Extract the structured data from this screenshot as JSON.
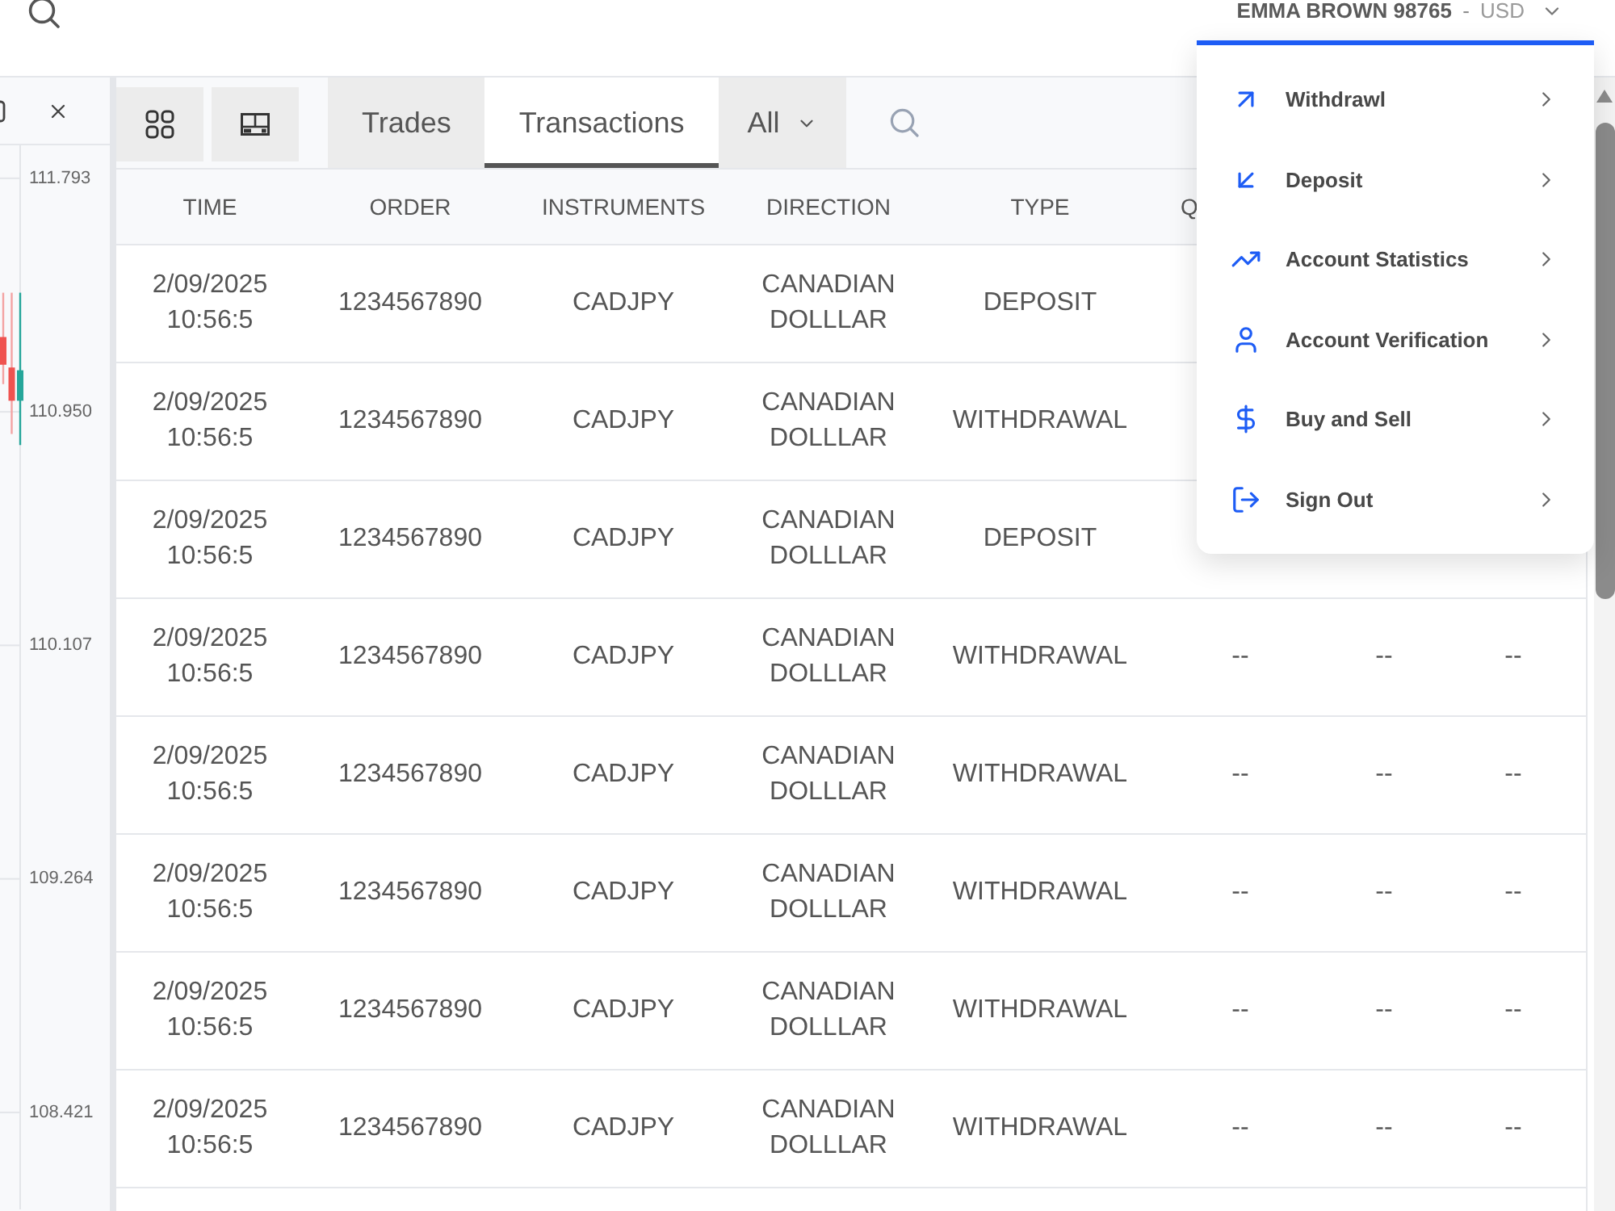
{
  "top_bar": {
    "account": {
      "name": "EMMA BROWN 98765",
      "separator": "-",
      "currency": "USD"
    }
  },
  "account_menu": {
    "expanded": true,
    "items": [
      {
        "kind": "withdraw",
        "label": "Withdrawl"
      },
      {
        "kind": "deposit",
        "label": "Deposit"
      },
      {
        "kind": "statistics",
        "label": "Account Statistics"
      },
      {
        "kind": "verification",
        "label": "Account Verification"
      },
      {
        "kind": "trade",
        "label": "Buy and Sell"
      },
      {
        "kind": "sign_out",
        "label": "Sign Out"
      }
    ]
  },
  "chart_panel": {
    "chart_data": [
      {
        "type": "candlestick",
        "categories": [
          null,
          null,
          null
        ],
        "ohlc": [
          [
            111.22,
            111.38,
            111.05,
            111.12
          ],
          [
            111.11,
            111.38,
            110.87,
            110.99
          ],
          [
            110.99,
            111.38,
            110.83,
            111.1
          ]
        ],
        "yticks": [
          108.421,
          109.264,
          110.107,
          {
            "value": 110.95,
            "label": "110.950"
          },
          111.793
        ],
        "ylim": [
          108.071,
          111.912
        ]
      }
    ]
  },
  "toolbar": {
    "tabs": [
      {
        "label": "Trades",
        "selected": false
      },
      {
        "label": "Transactions",
        "selected": true
      }
    ],
    "filter": {
      "value": "All"
    }
  },
  "table": {
    "columns": [
      "TIME",
      "ORDER",
      "INSTRUMENTS",
      "DIRECTION",
      "TYPE",
      "Q"
    ],
    "rows": [
      {
        "cells": [
          "2/09/2025 10:56:5",
          "1234567890",
          "CADJPY",
          "CANADIAN DOLLLAR",
          "DEPOSIT"
        ]
      },
      {
        "cells": [
          "2/09/2025 10:56:5",
          "1234567890",
          "CADJPY",
          "CANADIAN DOLLLAR",
          "WITHDRAWAL"
        ]
      },
      {
        "cells": [
          "2/09/2025 10:56:5",
          "1234567890",
          "CADJPY",
          "CANADIAN DOLLLAR",
          "DEPOSIT"
        ]
      },
      {
        "cells": [
          "2/09/2025 10:56:5",
          "1234567890",
          "CADJPY",
          "CANADIAN DOLLLAR",
          "WITHDRAWAL",
          "--",
          "--",
          "--"
        ]
      },
      {
        "cells": [
          "2/09/2025 10:56:5",
          "1234567890",
          "CADJPY",
          "CANADIAN DOLLLAR",
          "WITHDRAWAL",
          "--",
          "--",
          "--"
        ]
      },
      {
        "cells": [
          "2/09/2025 10:56:5",
          "1234567890",
          "CADJPY",
          "CANADIAN DOLLLAR",
          "WITHDRAWAL",
          "--",
          "--",
          "--"
        ]
      },
      {
        "cells": [
          "2/09/2025 10:56:5",
          "1234567890",
          "CADJPY",
          "CANADIAN DOLLLAR",
          "WITHDRAWAL",
          "--",
          "--",
          "--"
        ]
      },
      {
        "cells": [
          "2/09/2025 10:56:5",
          "1234567890",
          "CADJPY",
          "CANADIAN DOLLLAR",
          "WITHDRAWAL",
          "--",
          "--",
          "--"
        ]
      }
    ]
  }
}
